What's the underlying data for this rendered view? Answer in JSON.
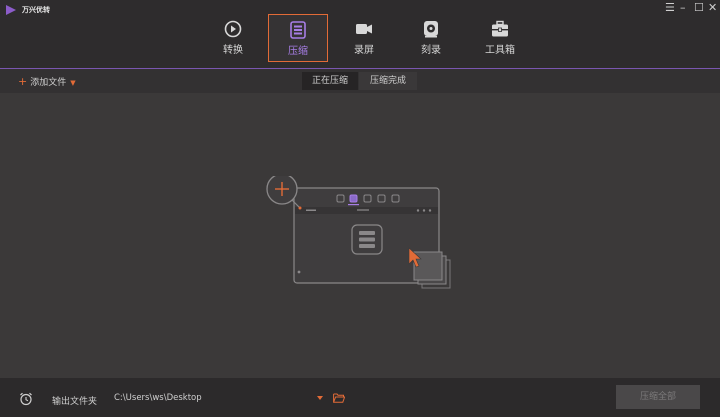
{
  "app": {
    "title": "万兴优转"
  },
  "window_controls": {
    "menu": "☰",
    "minimize": "–",
    "maximize": "☐",
    "close": "✕"
  },
  "nav": {
    "items": [
      {
        "label": "转换",
        "icon": "convert-icon",
        "active": false
      },
      {
        "label": "压缩",
        "icon": "compress-icon",
        "active": true
      },
      {
        "label": "录屏",
        "icon": "record-icon",
        "active": false
      },
      {
        "label": "刻录",
        "icon": "burn-disc-icon",
        "active": false
      },
      {
        "label": "工具箱",
        "icon": "toolbox-icon",
        "active": false
      }
    ]
  },
  "toolbar": {
    "add_file_label": "添加文件"
  },
  "tabs": [
    {
      "label": "正在压缩",
      "active": true
    },
    {
      "label": "压缩完成",
      "active": false
    }
  ],
  "output": {
    "label": "输出文件夹",
    "path": "C:\\Users\\ws\\Desktop"
  },
  "actions": {
    "compress_all_label": "压缩全部"
  },
  "colors": {
    "accent": "#e26b37",
    "brand": "#8c5cc9",
    "active_label": "#a77ee6",
    "background": "#3b3939"
  }
}
